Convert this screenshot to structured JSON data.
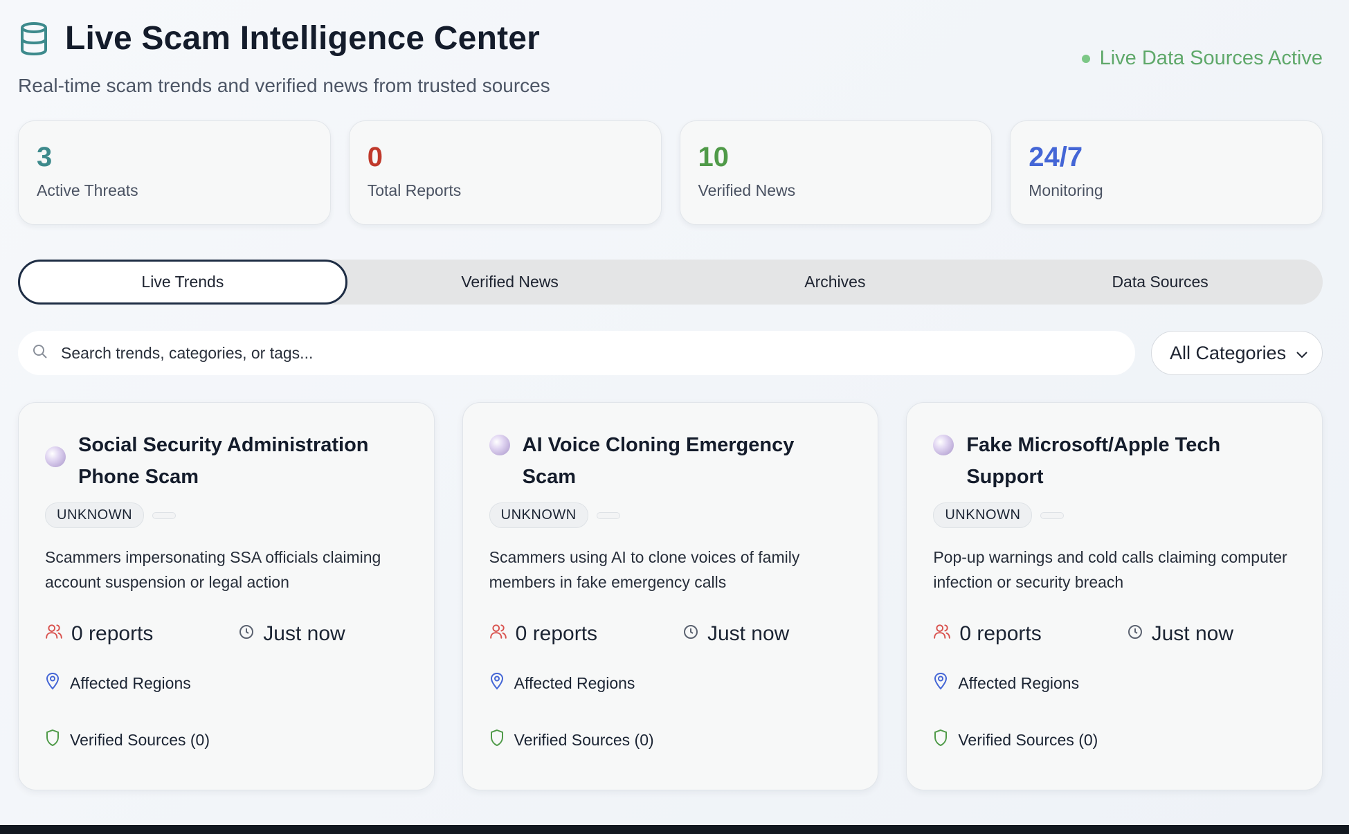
{
  "header": {
    "icon": "database-icon",
    "title": "Live Scam Intelligence Center",
    "subtitle": "Real-time scam trends and verified news from trusted sources",
    "status": "Live Data Sources Active"
  },
  "stats": [
    {
      "value": "3",
      "label": "Active Threats",
      "color": "#3d8a8c"
    },
    {
      "value": "0",
      "label": "Total Reports",
      "color": "#c0392b"
    },
    {
      "value": "10",
      "label": "Verified News",
      "color": "#4f9a48"
    },
    {
      "value": "24/7",
      "label": "Monitoring",
      "color": "#4466d6"
    }
  ],
  "tabs": [
    {
      "label": "Live Trends",
      "active": true
    },
    {
      "label": "Verified News",
      "active": false
    },
    {
      "label": "Archives",
      "active": false
    },
    {
      "label": "Data Sources",
      "active": false
    }
  ],
  "search": {
    "placeholder": "Search trends, categories, or tags...",
    "value": ""
  },
  "category_select": {
    "selected": "All Categories"
  },
  "cards": [
    {
      "title": "Social Security Administration Phone Scam",
      "badge": "UNKNOWN",
      "description": "Scammers impersonating SSA officials claiming account suspension or legal action",
      "reports": "0 reports",
      "time": "Just now",
      "regions_label": "Affected Regions",
      "sources_label": "Verified Sources (0)"
    },
    {
      "title": "AI Voice Cloning Emergency Scam",
      "badge": "UNKNOWN",
      "description": "Scammers using AI to clone voices of family members in fake emergency calls",
      "reports": "0 reports",
      "time": "Just now",
      "regions_label": "Affected Regions",
      "sources_label": "Verified Sources (0)"
    },
    {
      "title": "Fake Microsoft/Apple Tech Support",
      "badge": "UNKNOWN",
      "description": "Pop-up warnings and cold calls claiming computer infection or security breach",
      "reports": "0 reports",
      "time": "Just now",
      "regions_label": "Affected Regions",
      "sources_label": "Verified Sources (0)"
    }
  ],
  "colors": {
    "accent_teal": "#3d8a8c",
    "status_green": "#5fa86a",
    "reports_icon": "#d9534f",
    "regions_icon": "#4466d6",
    "sources_icon": "#4f9a48"
  }
}
